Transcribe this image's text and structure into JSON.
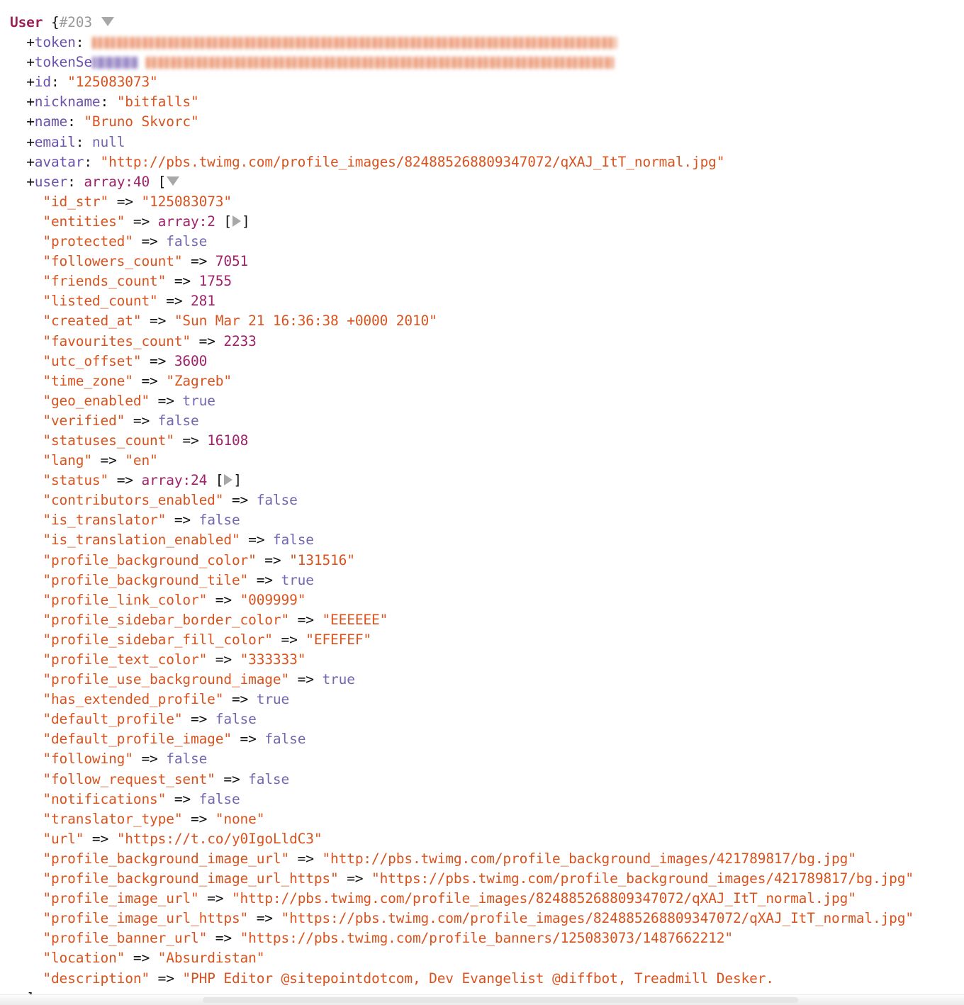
{
  "dump": {
    "class_name": "User",
    "object_id": "{#203",
    "open_toggle": "expand-collapse-triangle-down",
    "root_props": [
      {
        "name": "+token:",
        "value_redacted": true,
        "value": "",
        "kind": "redacted-string"
      },
      {
        "name": "+tokenSe",
        "name_redacted": true,
        "value_redacted": true,
        "value": "",
        "kind": "redacted-string"
      },
      {
        "name": "+id:",
        "value": "\"125083073\"",
        "kind": "string"
      },
      {
        "name": "+nickname:",
        "value": "\"bitfalls\"",
        "kind": "string"
      },
      {
        "name": "+name:",
        "value": "\"Bruno Skvorc\"",
        "kind": "string"
      },
      {
        "name": "+email:",
        "value": "null",
        "kind": "const"
      },
      {
        "name": "+avatar:",
        "value": "\"http://pbs.twimg.com/profile_images/824885268809347072/qXAJ_ItT_normal.jpg\"",
        "kind": "string"
      },
      {
        "name": "+user:",
        "value": "array:40",
        "kind": "array-open"
      }
    ],
    "user_array_label": "array:40",
    "user_entries": [
      {
        "key": "\"id_str\"",
        "arrow": "=>",
        "value": "\"125083073\"",
        "kind": "string"
      },
      {
        "key": "\"entities\"",
        "arrow": "=>",
        "value": "array:2",
        "kind": "array-collapsed"
      },
      {
        "key": "\"protected\"",
        "arrow": "=>",
        "value": "false",
        "kind": "const"
      },
      {
        "key": "\"followers_count\"",
        "arrow": "=>",
        "value": "7051",
        "kind": "number"
      },
      {
        "key": "\"friends_count\"",
        "arrow": "=>",
        "value": "1755",
        "kind": "number"
      },
      {
        "key": "\"listed_count\"",
        "arrow": "=>",
        "value": "281",
        "kind": "number"
      },
      {
        "key": "\"created_at\"",
        "arrow": "=>",
        "value": "\"Sun Mar 21 16:36:38 +0000 2010\"",
        "kind": "string"
      },
      {
        "key": "\"favourites_count\"",
        "arrow": "=>",
        "value": "2233",
        "kind": "number"
      },
      {
        "key": "\"utc_offset\"",
        "arrow": "=>",
        "value": "3600",
        "kind": "number"
      },
      {
        "key": "\"time_zone\"",
        "arrow": "=>",
        "value": "\"Zagreb\"",
        "kind": "string"
      },
      {
        "key": "\"geo_enabled\"",
        "arrow": "=>",
        "value": "true",
        "kind": "const"
      },
      {
        "key": "\"verified\"",
        "arrow": "=>",
        "value": "false",
        "kind": "const"
      },
      {
        "key": "\"statuses_count\"",
        "arrow": "=>",
        "value": "16108",
        "kind": "number"
      },
      {
        "key": "\"lang\"",
        "arrow": "=>",
        "value": "\"en\"",
        "kind": "string"
      },
      {
        "key": "\"status\"",
        "arrow": "=>",
        "value": "array:24",
        "kind": "array-collapsed"
      },
      {
        "key": "\"contributors_enabled\"",
        "arrow": "=>",
        "value": "false",
        "kind": "const"
      },
      {
        "key": "\"is_translator\"",
        "arrow": "=>",
        "value": "false",
        "kind": "const"
      },
      {
        "key": "\"is_translation_enabled\"",
        "arrow": "=>",
        "value": "false",
        "kind": "const"
      },
      {
        "key": "\"profile_background_color\"",
        "arrow": "=>",
        "value": "\"131516\"",
        "kind": "string"
      },
      {
        "key": "\"profile_background_tile\"",
        "arrow": "=>",
        "value": "true",
        "kind": "const"
      },
      {
        "key": "\"profile_link_color\"",
        "arrow": "=>",
        "value": "\"009999\"",
        "kind": "string"
      },
      {
        "key": "\"profile_sidebar_border_color\"",
        "arrow": "=>",
        "value": "\"EEEEEE\"",
        "kind": "string"
      },
      {
        "key": "\"profile_sidebar_fill_color\"",
        "arrow": "=>",
        "value": "\"EFEFEF\"",
        "kind": "string"
      },
      {
        "key": "\"profile_text_color\"",
        "arrow": "=>",
        "value": "\"333333\"",
        "kind": "string"
      },
      {
        "key": "\"profile_use_background_image\"",
        "arrow": "=>",
        "value": "true",
        "kind": "const"
      },
      {
        "key": "\"has_extended_profile\"",
        "arrow": "=>",
        "value": "true",
        "kind": "const"
      },
      {
        "key": "\"default_profile\"",
        "arrow": "=>",
        "value": "false",
        "kind": "const"
      },
      {
        "key": "\"default_profile_image\"",
        "arrow": "=>",
        "value": "false",
        "kind": "const"
      },
      {
        "key": "\"following\"",
        "arrow": "=>",
        "value": "false",
        "kind": "const"
      },
      {
        "key": "\"follow_request_sent\"",
        "arrow": "=>",
        "value": "false",
        "kind": "const"
      },
      {
        "key": "\"notifications\"",
        "arrow": "=>",
        "value": "false",
        "kind": "const"
      },
      {
        "key": "\"translator_type\"",
        "arrow": "=>",
        "value": "\"none\"",
        "kind": "string"
      },
      {
        "key": "\"url\"",
        "arrow": "=>",
        "value": "\"https://t.co/y0IgoLldC3\"",
        "kind": "string"
      },
      {
        "key": "\"profile_background_image_url\"",
        "arrow": "=>",
        "value": "\"http://pbs.twimg.com/profile_background_images/421789817/bg.jpg\"",
        "kind": "string"
      },
      {
        "key": "\"profile_background_image_url_https\"",
        "arrow": "=>",
        "value": "\"https://pbs.twimg.com/profile_background_images/421789817/bg.jpg\"",
        "kind": "string"
      },
      {
        "key": "\"profile_image_url\"",
        "arrow": "=>",
        "value": "\"http://pbs.twimg.com/profile_images/824885268809347072/qXAJ_ItT_normal.jpg\"",
        "kind": "string"
      },
      {
        "key": "\"profile_image_url_https\"",
        "arrow": "=>",
        "value": "\"https://pbs.twimg.com/profile_images/824885268809347072/qXAJ_ItT_normal.jpg\"",
        "kind": "string"
      },
      {
        "key": "\"profile_banner_url\"",
        "arrow": "=>",
        "value": "\"https://pbs.twimg.com/profile_banners/125083073/1487662212\"",
        "kind": "string"
      },
      {
        "key": "\"location\"",
        "arrow": "=>",
        "value": "\"Absurdistan\"",
        "kind": "string"
      },
      {
        "key": "\"description\"",
        "arrow": "=>",
        "value": "\"PHP Editor @sitepointdotcom, Dev Evangelist @diffbot, Treadmill Desker.",
        "kind": "string"
      }
    ],
    "closing_bracket": "]",
    "colors": {
      "class_name": "#9b2257",
      "object_id": "#9a9a9a",
      "property": "#6b52ae",
      "key_string": "#d9531e",
      "number": "#a0226a",
      "constant": "#7367b0",
      "array_count": "#a0226a",
      "punctuation": "#111111",
      "toggle_triangle": "#a8a8a8",
      "background": "#ffffff"
    }
  },
  "scrollbar": {
    "orientation": "horizontal",
    "name": "horizontal-scrollbar"
  }
}
